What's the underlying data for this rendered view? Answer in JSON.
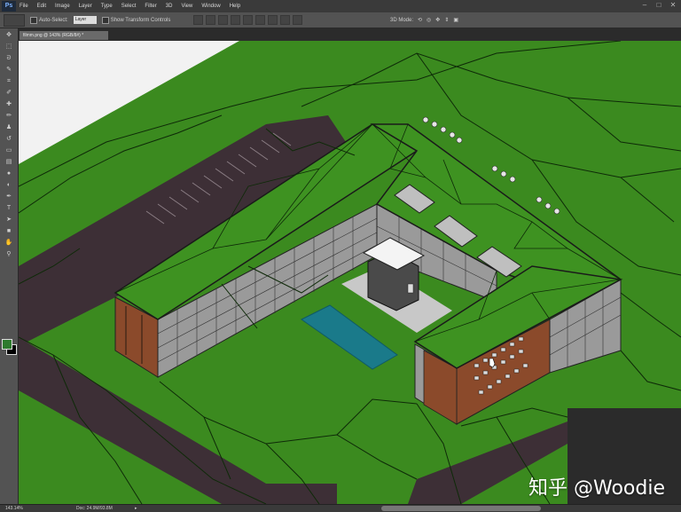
{
  "app": {
    "logo": "Ps"
  },
  "menu": [
    "File",
    "Edit",
    "Image",
    "Layer",
    "Type",
    "Select",
    "Filter",
    "3D",
    "View",
    "Window",
    "Help"
  ],
  "options": {
    "auto_select_label": "Auto-Select:",
    "auto_select_value": "Layer",
    "show_transform_label": "Show Transform Controls",
    "mode_3d_label": "3D Mode:"
  },
  "document": {
    "tab_title": "filmm.png @ 143% (RGB/8#) *"
  },
  "status": {
    "zoom": "143.14%",
    "doc_info": "Doc: 24.9M/93.8M",
    "arrow": "▸"
  },
  "watermark": "知乎 @Woodie",
  "colors": {
    "ground": "#3b8a1f",
    "roof": "#3e9221",
    "road": "#3d2f36",
    "brick": "#8b4a2b",
    "pool": "#1a7a8a",
    "courtyard": "#c8c8c8"
  },
  "icons": [
    "move-tool-icon",
    "marquee-tool-icon",
    "lasso-tool-icon",
    "quick-select-icon",
    "crop-tool-icon",
    "eyedropper-icon",
    "healing-brush-icon",
    "brush-tool-icon",
    "clone-stamp-icon",
    "history-brush-icon",
    "eraser-icon",
    "gradient-icon",
    "blur-icon",
    "dodge-icon",
    "pen-tool-icon",
    "type-tool-icon",
    "path-select-icon",
    "shape-tool-icon",
    "hand-tool-icon",
    "zoom-tool-icon"
  ]
}
